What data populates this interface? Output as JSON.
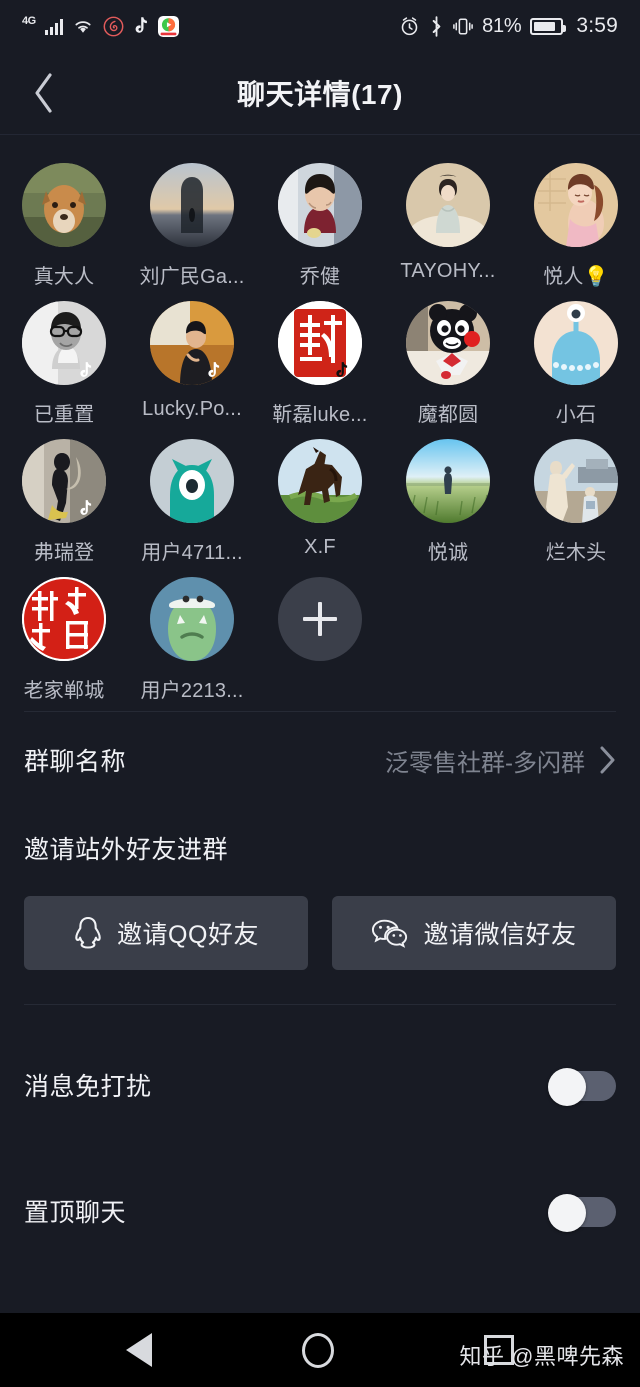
{
  "status_bar": {
    "network_label": "4G",
    "icons_left": [
      "signal-bars-icon",
      "wifi-icon",
      "netease-music-icon",
      "tiktok-icon",
      "video-app-icon"
    ],
    "icons_right": [
      "alarm-icon",
      "bluetooth-icon",
      "vibrate-icon"
    ],
    "battery_percent": "81%",
    "time": "3:59"
  },
  "header": {
    "back_icon": "chevron-left-icon",
    "title": "聊天详情(17)"
  },
  "members": [
    {
      "name": "真大人",
      "avatar": "dog-photo",
      "tiktok_badge": false
    },
    {
      "name": "刘广民Ga...",
      "avatar": "sunset-silhouette",
      "tiktok_badge": false
    },
    {
      "name": "乔健",
      "avatar": "woman-indoor",
      "tiktok_badge": false
    },
    {
      "name": "TAYOHY...",
      "avatar": "hanfu-woman",
      "tiktok_badge": false
    },
    {
      "name": "悦人💡",
      "avatar": "retro-poster",
      "tiktok_badge": false
    },
    {
      "name": "已重置",
      "avatar": "man-glasses-bw",
      "tiktok_badge": true
    },
    {
      "name": "Lucky.Po...",
      "avatar": "man-presenting",
      "tiktok_badge": true
    },
    {
      "name": "靳磊luke...",
      "avatar": "red-seal-stamp",
      "tiktok_badge": true
    },
    {
      "name": "魔都圆",
      "avatar": "kumamon-bear",
      "tiktok_badge": false
    },
    {
      "name": "小石",
      "avatar": "blue-monster",
      "tiktok_badge": false
    },
    {
      "name": "弗瑞登",
      "avatar": "person-walking",
      "tiktok_badge": true
    },
    {
      "name": "用户4711...",
      "avatar": "teal-cyclops",
      "tiktok_badge": false
    },
    {
      "name": "X.F",
      "avatar": "horse-field",
      "tiktok_badge": false
    },
    {
      "name": "悦诚",
      "avatar": "person-grassland",
      "tiktok_badge": false
    },
    {
      "name": "烂木头",
      "avatar": "beach-family",
      "tiktok_badge": false
    },
    {
      "name": "老家郸城",
      "avatar": "red-seal-laojia",
      "tiktok_badge": false
    },
    {
      "name": "用户2213...",
      "avatar": "green-monster",
      "tiktok_badge": false
    }
  ],
  "add_member_button": {
    "icon": "plus-icon",
    "label": ""
  },
  "group_name_row": {
    "label": "群聊名称",
    "value": "泛零售社群-多闪群",
    "chevron": "chevron-right-icon"
  },
  "invite_section": {
    "title": "邀请站外好友进群",
    "buttons": [
      {
        "label": "邀请QQ好友",
        "icon": "qq-penguin-icon"
      },
      {
        "label": "邀请微信好友",
        "icon": "wechat-icon"
      }
    ]
  },
  "settings": [
    {
      "label": "消息免打扰",
      "toggle": "off"
    },
    {
      "label": "置顶聊天",
      "toggle": "off"
    }
  ],
  "nav_bar": {
    "back": "nav-back-triangle-icon",
    "home": "nav-home-circle-icon",
    "recents": "nav-recents-square-icon"
  },
  "watermark": "知乎 @黑啤先森",
  "colors": {
    "background": "#181b24",
    "button_bg": "#3a3e49",
    "text_primary": "#f0f1f5",
    "text_secondary": "#7f8490",
    "divider": "#262a35"
  }
}
